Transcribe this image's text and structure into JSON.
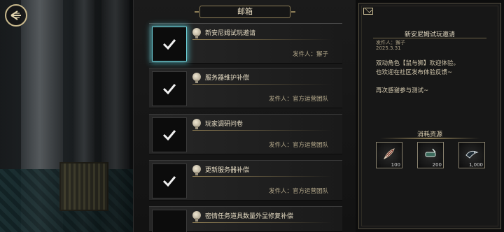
{
  "mailbox": {
    "title": "邮箱",
    "items": [
      {
        "title": "新安尼姆试玩邀请",
        "sender": "发件人：獬子",
        "selected": true
      },
      {
        "title": "服务器维护补偿",
        "sender": "发件人：官方运营团队",
        "selected": false
      },
      {
        "title": "玩家调研问卷",
        "sender": "发件人：官方运营团队",
        "selected": false
      },
      {
        "title": "更新服务器补偿",
        "sender": "发件人：官方运营团队",
        "selected": false
      },
      {
        "title": "密情任务道具数量外显修复补偿",
        "sender": "",
        "selected": false
      }
    ]
  },
  "detail": {
    "title": "新安尼姆试玩邀请",
    "sender": "发件人：獬子",
    "date": "2025.3.31",
    "body": [
      "双动角色【鼠与狮】欢迎体验。",
      "也欢迎在社区发布体验反馈~",
      "",
      "再次感谢参与测试~"
    ],
    "resources_label": "消耗资源",
    "resources": [
      {
        "icon": "red-feather-icon",
        "count": "100"
      },
      {
        "icon": "green-scroll-icon",
        "count": "200"
      },
      {
        "icon": "raven-icon",
        "count": "1,000"
      }
    ]
  },
  "colors": {
    "accent_gold": "#8f7f58",
    "selected_glow": "#6fd3dc",
    "panel_bg": "#171717"
  }
}
